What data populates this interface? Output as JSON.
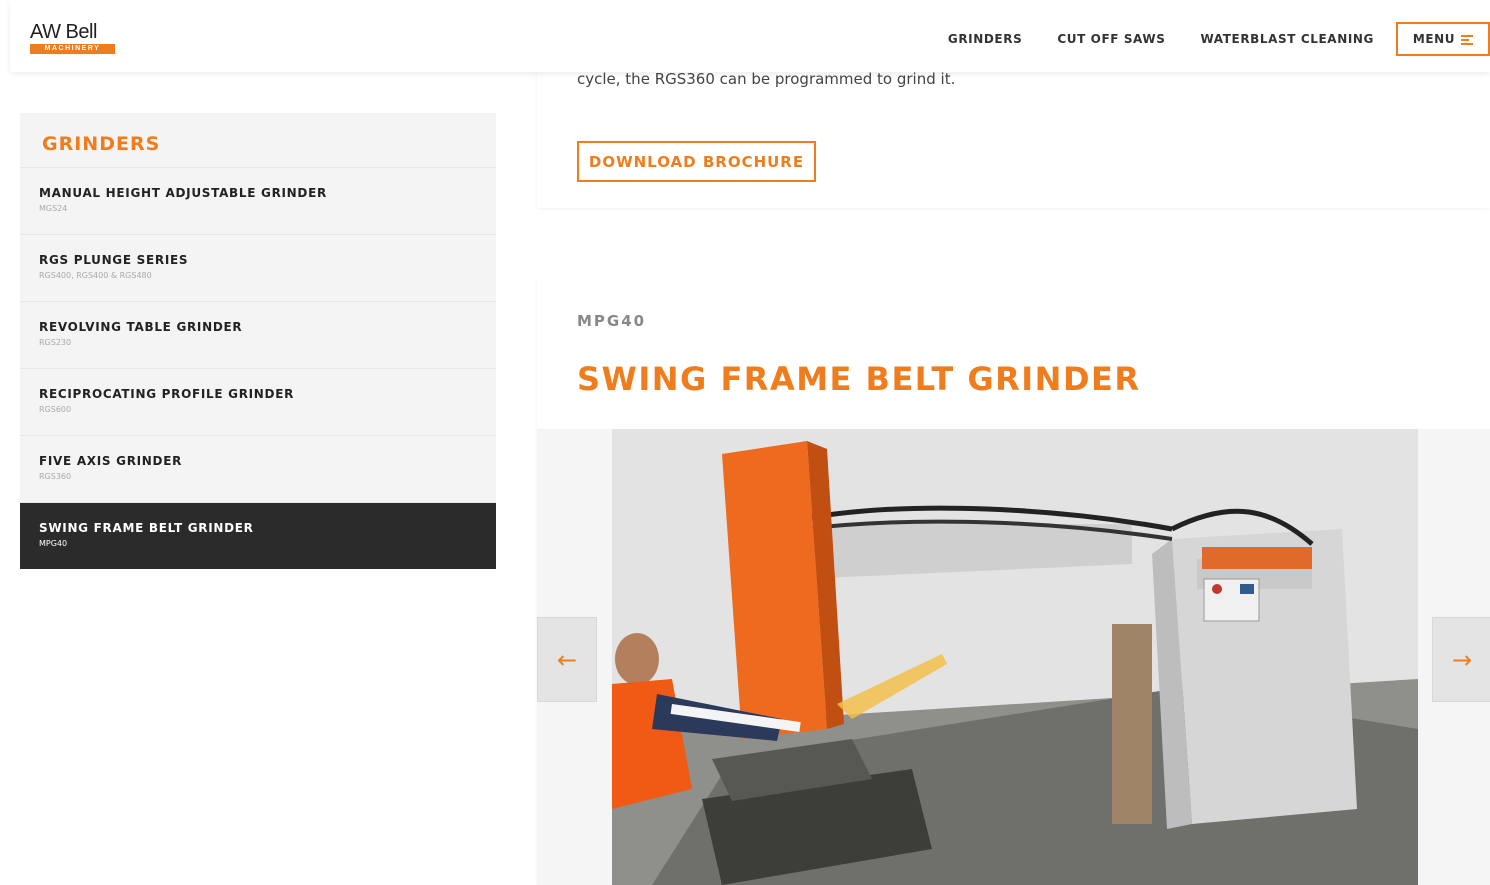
{
  "header": {
    "logo_text": "AW Bell",
    "logo_sub": "MACHINERY",
    "nav": [
      "GRINDERS",
      "CUT OFF SAWS",
      "WATERBLAST CLEANING"
    ],
    "menu_label": "MENU"
  },
  "sidebar": {
    "title": "GRINDERS",
    "items": [
      {
        "name": "MANUAL HEIGHT ADJUSTABLE GRINDER",
        "code": "MGS24"
      },
      {
        "name": "RGS PLUNGE SERIES",
        "code": "RGS400, RGS400 & RGS480"
      },
      {
        "name": "REVOLVING TABLE GRINDER",
        "code": "RGS230"
      },
      {
        "name": "RECIPROCATING PROFILE GRINDER",
        "code": "RGS600"
      },
      {
        "name": "FIVE AXIS GRINDER",
        "code": "RGS360"
      },
      {
        "name": "SWING FRAME BELT GRINDER",
        "code": "MPG40",
        "active": true
      }
    ]
  },
  "intro": {
    "text": "cycle, the RGS360 can be programmed to grind it.",
    "brochure_label": "DOWNLOAD BROCHURE"
  },
  "product": {
    "model": "MPG40",
    "title": "SWING FRAME BELT GRINDER"
  },
  "gallery": {
    "prev_icon": "arrow-left-icon",
    "next_icon": "arrow-right-icon"
  },
  "colors": {
    "accent": "#f07d1d",
    "active_bg": "#2b2b2b",
    "sidebar_bg": "#f4f4f4"
  }
}
